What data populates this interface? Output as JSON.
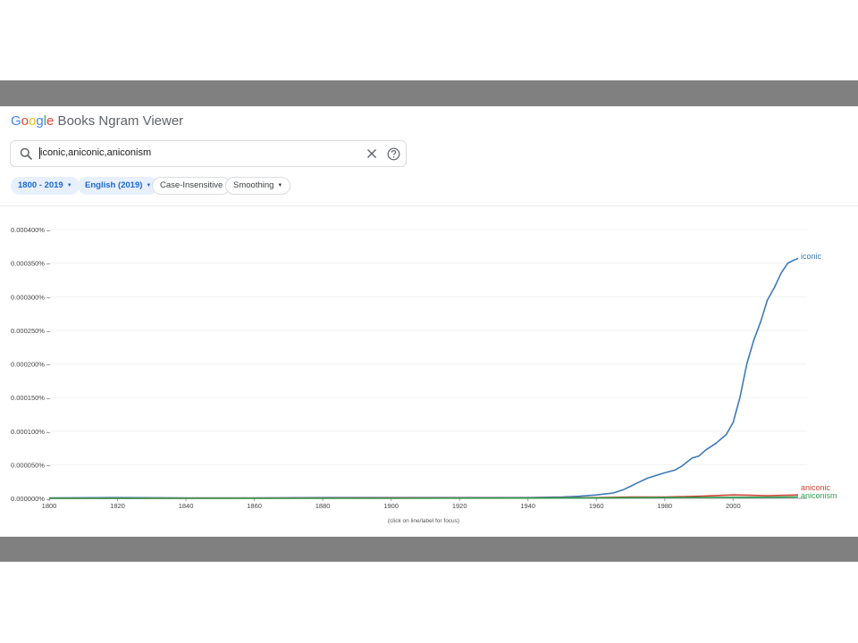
{
  "header": {
    "logo_letters": [
      "G",
      "o",
      "o",
      "g",
      "l",
      "e"
    ],
    "title_rest": " Books Ngram Viewer"
  },
  "search": {
    "query": "iconic,aniconic,aniconism",
    "clear_icon": "close-icon",
    "help_icon": "help-circle-icon",
    "search_icon": "search-icon"
  },
  "filters": {
    "year_range": "1800 - 2019",
    "corpus": "English (2019)",
    "case": "Case-Insensitive",
    "smoothing": "Smoothing"
  },
  "colors": {
    "iconic": "#3d7ab8",
    "aniconic": "#cc4436",
    "aniconism": "#2f9e4f",
    "band": "#808080"
  },
  "chart_data": {
    "type": "line",
    "x_ticks": [
      "1800",
      "1820",
      "1840",
      "1860",
      "1880",
      "1900",
      "1920",
      "1940",
      "1960",
      "1980",
      "2000"
    ],
    "y_ticks": [
      "0.000000%",
      "0.000050%",
      "0.000100%",
      "0.000150%",
      "0.000200%",
      "0.000250%",
      "0.000300%",
      "0.000350%",
      "0.000400%"
    ],
    "xlim": [
      1800,
      2019
    ],
    "ylim": [
      0,
      0.0004
    ],
    "y_unit": "%",
    "grid": true,
    "hint": "(click on line/label for focus)",
    "series": [
      {
        "name": "iconic",
        "x": [
          1800,
          1820,
          1840,
          1860,
          1880,
          1900,
          1920,
          1940,
          1950,
          1955,
          1960,
          1965,
          1968,
          1970,
          1972,
          1975,
          1978,
          1980,
          1983,
          1985,
          1988,
          1990,
          1992,
          1995,
          1998,
          2000,
          2002,
          2004,
          2006,
          2008,
          2010,
          2012,
          2014,
          2016,
          2018,
          2019
        ],
        "values": [
          5e-07,
          1e-06,
          5e-07,
          5e-07,
          1e-06,
          1e-06,
          1e-06,
          1e-06,
          2e-06,
          3e-06,
          5e-06,
          8e-06,
          1.3e-05,
          1.8e-05,
          2.3e-05,
          3e-05,
          3.5e-05,
          3.8e-05,
          4.2e-05,
          4.8e-05,
          6e-05,
          6.3e-05,
          7.2e-05,
          8.2e-05,
          9.5e-05,
          0.000113,
          0.00015,
          0.0002,
          0.000235,
          0.000262,
          0.000295,
          0.000313,
          0.000335,
          0.00035,
          0.000355,
          0.000357
        ]
      },
      {
        "name": "aniconic",
        "x": [
          1800,
          1900,
          1940,
          1960,
          1970,
          1980,
          1990,
          2000,
          2005,
          2010,
          2019
        ],
        "values": [
          0,
          5e-07,
          5e-07,
          1e-06,
          2e-06,
          2e-06,
          3e-06,
          5e-06,
          4.5e-06,
          4e-06,
          5e-06
        ]
      },
      {
        "name": "aniconism",
        "x": [
          1800,
          1880,
          1900,
          1960,
          1980,
          2000,
          2019
        ],
        "values": [
          0,
          0,
          0,
          5e-07,
          1e-06,
          1.5e-06,
          2e-06
        ]
      }
    ]
  }
}
